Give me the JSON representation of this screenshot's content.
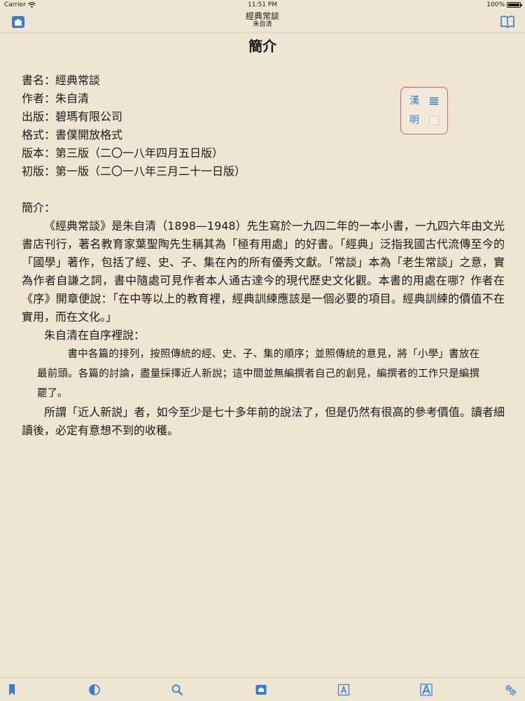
{
  "status_bar": {
    "carrier": "Carrier",
    "time": "11:51 PM",
    "battery": "100%"
  },
  "nav": {
    "title": "經典常談",
    "subtitle": "朱自清",
    "left_icon": "library-icon",
    "right_icon": "book-icon"
  },
  "page": {
    "heading": "簡介"
  },
  "meta": [
    "書名：經典常談",
    "作者：朱自清",
    "出版：碧瑪有限公司",
    "格式：書僕開放格式",
    "版本：第三版（二〇一八年四月五日版）",
    "初版：第一版（二〇一八年三月二十一日版）"
  ],
  "intro_label": "簡介：",
  "paragraphs": {
    "p1": "《經典常談》是朱自清（1898—1948）先生寫於一九四二年的一本小書，一九四六年由文光書店刊行，著名教育家葉聖陶先生稱其為「極有用處」的好書。「經典」泛指我國古代流傳至今的「國學」著作，包括了經、史、子、集在內的所有優秀文獻。「常談」本為「老生常談」之意，實為作者自謙之詞，書中隨處可見作者本人通古達今的現代歷史文化觀。本書的用處在哪？作者在《序》開章便說：「在中等以上的教育裡，經典訓練應該是一個必要的項目。經典訓練的價值不在實用，而在文化。」",
    "p2": "朱自清在自序裡說：",
    "quote": "書中各篇的排列，按照傳統的經、史、子、集的順序；並照傳統的意見，將「小學」書放在最前頭。各篇的討論，盡量採擇近人新說；這中間並無編撰者自己的創見，編撰者的工作只是編撰罷了。",
    "p3": "所謂「近人新説」者，如今至少是七十多年前的說法了，但是仍然有很高的參考價值。讀者細讀後，必定有意想不到的收穫。"
  },
  "script_toggle": {
    "han": "漢",
    "ming": "明"
  },
  "toolbar": {
    "icons": [
      "bookmark-icon",
      "contrast-icon",
      "search-icon",
      "library-icon",
      "font-smaller-icon",
      "font-larger-icon",
      "settings-icon"
    ]
  },
  "colors": {
    "background": "#efe5d2",
    "accent": "#2f7fd8",
    "panel_border": "#e35a6a"
  }
}
